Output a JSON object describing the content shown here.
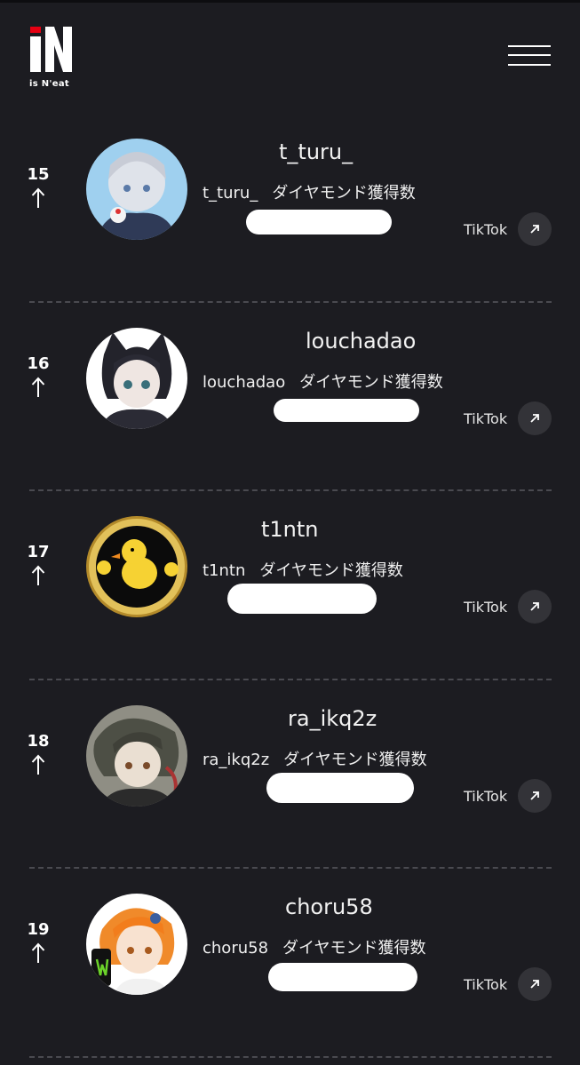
{
  "header": {
    "logo_caption": "is N'eat",
    "menu_icon": "hamburger-menu-icon"
  },
  "colors": {
    "background": "#1c1c21",
    "logo_accent": "#e60012",
    "button_bg": "#333338"
  },
  "ranking": [
    {
      "rank": "15",
      "trend": "up",
      "name": "t_turu_",
      "account": "t_turu_",
      "metric": "ダイヤモンド獲得数",
      "platform": "TikTok",
      "external_icon": "external-link-arrow-icon"
    },
    {
      "rank": "16",
      "trend": "up",
      "name": "louchadao",
      "account": "louchadao",
      "metric": "ダイヤモンド獲得数",
      "platform": "TikTok",
      "external_icon": "external-link-arrow-icon"
    },
    {
      "rank": "17",
      "trend": "up",
      "name": "t1ntn",
      "account": "t1ntn",
      "metric": "ダイヤモンド獲得数",
      "platform": "TikTok",
      "external_icon": "external-link-arrow-icon"
    },
    {
      "rank": "18",
      "trend": "up",
      "name": "ra_ikq2z",
      "account": "ra_ikq2z",
      "metric": "ダイヤモンド獲得数",
      "platform": "TikTok",
      "external_icon": "external-link-arrow-icon"
    },
    {
      "rank": "19",
      "trend": "up",
      "name": "choru58",
      "account": "choru58",
      "metric": "ダイヤモンド獲得数",
      "platform": "TikTok",
      "external_icon": "external-link-arrow-icon"
    }
  ]
}
